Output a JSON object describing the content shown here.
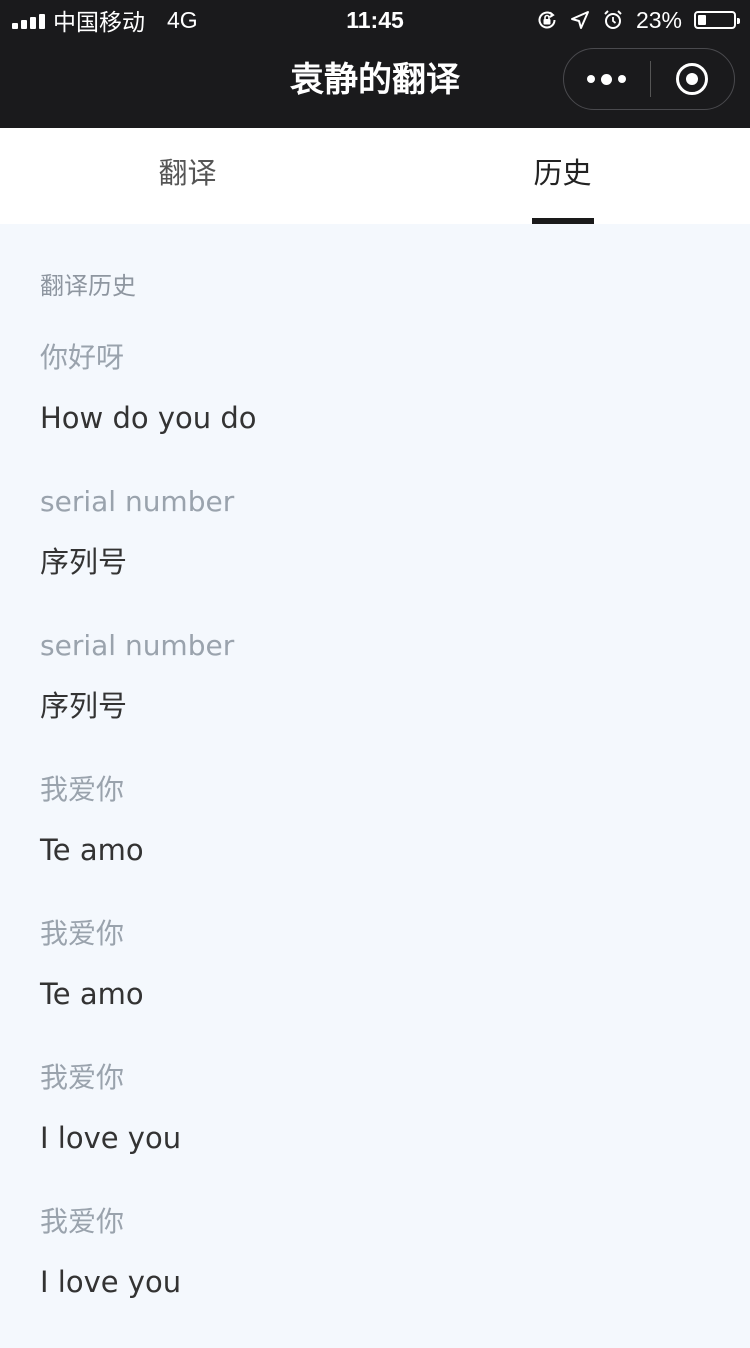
{
  "status_bar": {
    "carrier": "中国移动",
    "network": "4G",
    "time": "11:45",
    "battery_percent": "23%",
    "battery_level": 0.23
  },
  "navbar": {
    "title": "袁静的翻译"
  },
  "tabs": [
    {
      "label": "翻译",
      "active": false
    },
    {
      "label": "历史",
      "active": true
    }
  ],
  "history": {
    "title": "翻译历史",
    "items": [
      {
        "source": "你好呀",
        "result": "How do you do"
      },
      {
        "source": "serial number",
        "result": "序列号"
      },
      {
        "source": "serial number",
        "result": "序列号"
      },
      {
        "source": "我爱你",
        "result": "Te amo"
      },
      {
        "source": "我爱你",
        "result": "Te amo"
      },
      {
        "source": "我爱你",
        "result": "I love you"
      },
      {
        "source": "我爱你",
        "result": "I love you"
      }
    ]
  },
  "icons": {
    "signal": "signal-bars-icon",
    "rotation_lock": "rotation-lock-icon",
    "location": "location-arrow-icon",
    "alarm": "alarm-clock-icon",
    "battery": "battery-icon",
    "more": "more-dots-icon",
    "close": "target-circle-icon"
  }
}
